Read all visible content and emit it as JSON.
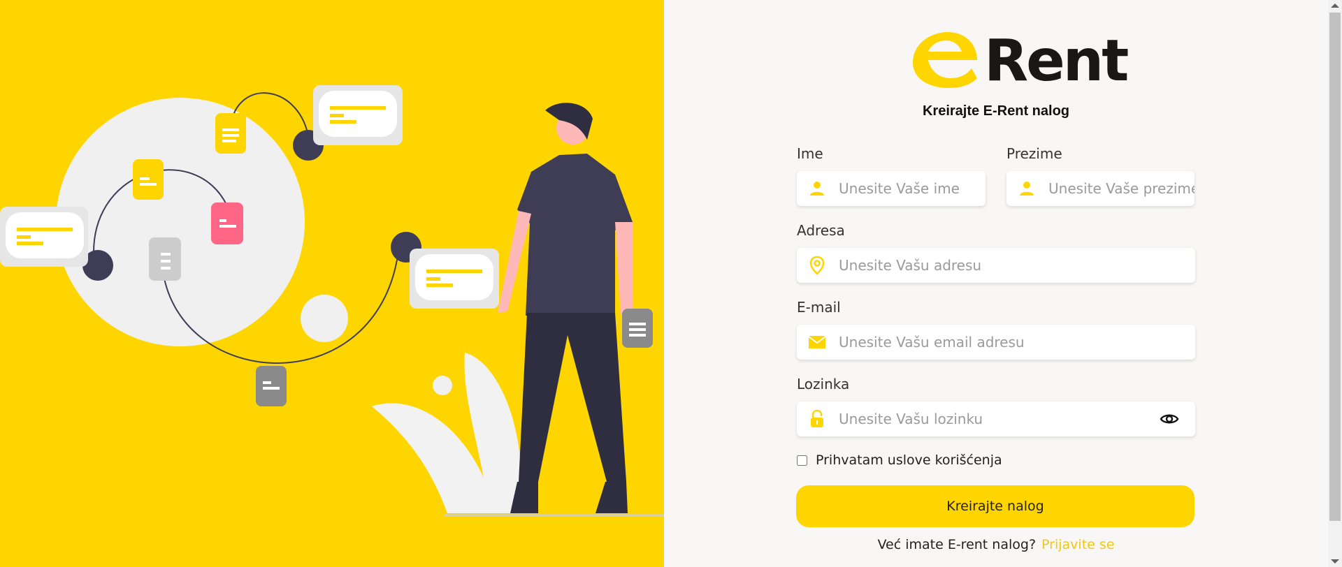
{
  "colors": {
    "brand_yellow": "#ffd500",
    "dark": "#1a1717",
    "link": "#f1c618",
    "accent_red": "#ff6584",
    "figure_dark": "#3f3d56"
  },
  "logo": {
    "text": "Rent"
  },
  "subtitle": "Kreirajte E-Rent nalog",
  "fields": {
    "first_name": {
      "label": "Ime",
      "placeholder": "Unesite Vaše ime",
      "icon": "user-icon"
    },
    "last_name": {
      "label": "Prezime",
      "placeholder": "Unesite Vaše prezime",
      "icon": "user-icon"
    },
    "address": {
      "label": "Adresa",
      "placeholder": "Unesite Vašu adresu",
      "icon": "map-pin-icon"
    },
    "email": {
      "label": "E-mail",
      "placeholder": "Unesite Vašu email adresu",
      "icon": "envelope-icon"
    },
    "password": {
      "label": "Lozinka",
      "placeholder": "Unesite Vašu lozinku",
      "icon": "lock-icon"
    }
  },
  "terms_label": "Prihvatam uslove korišćenja",
  "submit_label": "Kreirajte nalog",
  "login_prompt": "Već imate E-rent nalog?",
  "login_link": "Prijavite se"
}
